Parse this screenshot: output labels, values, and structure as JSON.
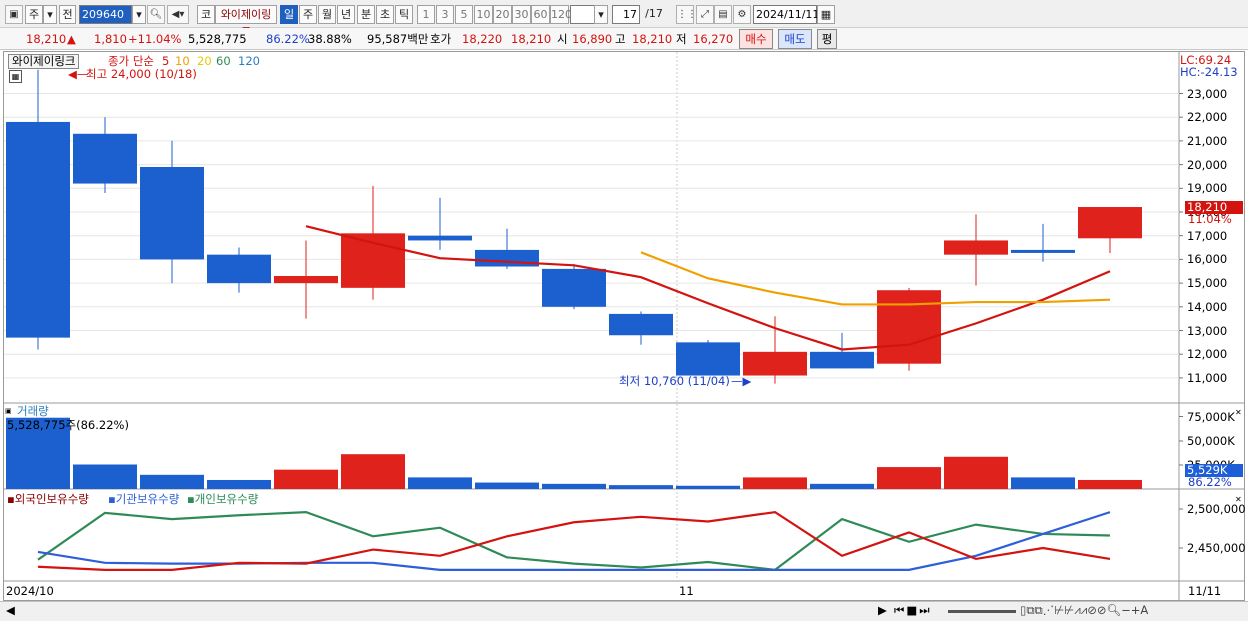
{
  "toolbar": {
    "market_btn": "주",
    "prev_btn": "전",
    "stock_code": "209640",
    "market_label": "코",
    "stock_name": "와이제이링크",
    "periods": [
      "일",
      "주",
      "월",
      "년",
      "분",
      "초",
      "틱"
    ],
    "selected_period": "일",
    "intervals": [
      "1",
      "3",
      "5",
      "10",
      "20",
      "30",
      "60",
      "120"
    ],
    "count": "17",
    "total": "/17",
    "date": "2024/11/11"
  },
  "quote": {
    "price": "18,210",
    "change": "1,810",
    "change_pct": "+11.04%",
    "volume": "5,528,775",
    "vol_ratio": "86.22%",
    "turnover": "38.88%",
    "amount": "95,587백만",
    "ask_label": "호가",
    "ask": "18,220",
    "bid": "18,210",
    "open_label": "시",
    "open": "16,890",
    "high_label": "고",
    "high": "18,210",
    "low_label": "저",
    "low": "16,270",
    "buy_btn": "매수",
    "sell_btn": "매도",
    "eval_btn": "평"
  },
  "price_panel": {
    "name": "와이제이링크",
    "ma_title": "종가 단순",
    "ma_periods": [
      "5",
      "10",
      "20",
      "60",
      "120"
    ],
    "ma_colors": [
      "#d3130f",
      "#f0a000",
      "#e8c800",
      "#2e8b57",
      "#2a7fbf"
    ],
    "max_note": "최고 24,000 (10/18)",
    "min_note": "최저 10,760 (11/04)",
    "lc": "LC:69.24",
    "hc": "HC:-24.13",
    "price_tag": "18,210",
    "pct_tag": "11.04%",
    "y_ticks": [
      "23,000",
      "22,000",
      "21,000",
      "20,000",
      "19,000",
      "18,000",
      "17,000",
      "16,000",
      "15,000",
      "14,000",
      "13,000",
      "12,000",
      "11,000"
    ]
  },
  "volume_panel": {
    "title": "거래량",
    "note": "5,528,775주(86.22%)",
    "y_ticks": [
      "75,000K",
      "50,000K",
      "25,000K"
    ],
    "vol_tag": "5,529K",
    "pct_tag": "86.22%"
  },
  "holdings_panel": {
    "legend": [
      "외국인보유수량",
      "기관보유수량",
      "개인보유수량"
    ],
    "colors": [
      "#d3130f",
      "#2e5fd8",
      "#2e8b57"
    ],
    "y_ticks": [
      "2,500,000",
      "2,450,000"
    ]
  },
  "x_axis": {
    "start": "2024/10",
    "mid": "11",
    "end": "11/11"
  },
  "chart_data": {
    "type": "candlestick",
    "title": "와이제이링크",
    "ylim": [
      10300,
      24400
    ],
    "candles": [
      {
        "o": 21800,
        "h": 24000,
        "l": 12200,
        "c": 12700,
        "v": 5528775
      },
      {
        "o": 21300,
        "h": 22000,
        "l": 18800,
        "c": 19200,
        "v": 1900000
      },
      {
        "o": 19900,
        "h": 21000,
        "l": 15000,
        "c": 16000,
        "v": 1100000
      },
      {
        "o": 16200,
        "h": 16500,
        "l": 14600,
        "c": 15000,
        "v": 700000
      },
      {
        "o": 15000,
        "h": 16800,
        "l": 13500,
        "c": 15300,
        "v": 1500000
      },
      {
        "o": 14800,
        "h": 19100,
        "l": 14300,
        "c": 17100,
        "v": 2700000
      },
      {
        "o": 17000,
        "h": 18600,
        "l": 16400,
        "c": 16800,
        "v": 900000
      },
      {
        "o": 16400,
        "h": 17300,
        "l": 15600,
        "c": 15700,
        "v": 500000
      },
      {
        "o": 15600,
        "h": 15800,
        "l": 13900,
        "c": 14000,
        "v": 400000
      },
      {
        "o": 13700,
        "h": 13800,
        "l": 12400,
        "c": 12800,
        "v": 300000
      },
      {
        "o": 12500,
        "h": 12600,
        "l": 11100,
        "c": 11100,
        "v": 250000
      },
      {
        "o": 11100,
        "h": 13600,
        "l": 10760,
        "c": 12100,
        "v": 900000
      },
      {
        "o": 12100,
        "h": 12900,
        "l": 11400,
        "c": 11400,
        "v": 400000
      },
      {
        "o": 11600,
        "h": 14800,
        "l": 11300,
        "c": 14700,
        "v": 1700000
      },
      {
        "o": 16200,
        "h": 17900,
        "l": 14900,
        "c": 16800,
        "v": 2500000
      },
      {
        "o": 16400,
        "h": 17500,
        "l": 15900,
        "c": 16300,
        "v": 900000
      },
      {
        "o": 16890,
        "h": 18210,
        "l": 16270,
        "c": 18210,
        "v": 700000
      }
    ],
    "ma5": [
      null,
      null,
      null,
      null,
      17400,
      16700,
      16050,
      15900,
      15750,
      15250,
      14150,
      13100,
      12200,
      12400,
      13300,
      14300,
      15500
    ],
    "ma10": [
      null,
      null,
      null,
      null,
      null,
      null,
      null,
      null,
      null,
      16300,
      15200,
      14600,
      14100,
      14100,
      14200,
      14200,
      14300
    ],
    "holdings": {
      "foreign": [
        2426000,
        2422000,
        2422000,
        2431000,
        2430000,
        2448000,
        2440000,
        2465000,
        2483000,
        2490000,
        2484000,
        2496000,
        2440000,
        2470000,
        2436000,
        2450000,
        2436000
      ],
      "institution": [
        2445000,
        2431000,
        2430000,
        2430000,
        2431000,
        2431000,
        2422000,
        2422000,
        2422000,
        2422000,
        2422000,
        2422000,
        2422000,
        2422000,
        2440000,
        2468000,
        2496000
      ],
      "individual": [
        2435000,
        2495000,
        2487000,
        2492000,
        2496000,
        2465000,
        2476000,
        2438000,
        2430000,
        2425000,
        2432000,
        2422000,
        2487000,
        2458000,
        2480000,
        2468000,
        2466000
      ]
    }
  }
}
